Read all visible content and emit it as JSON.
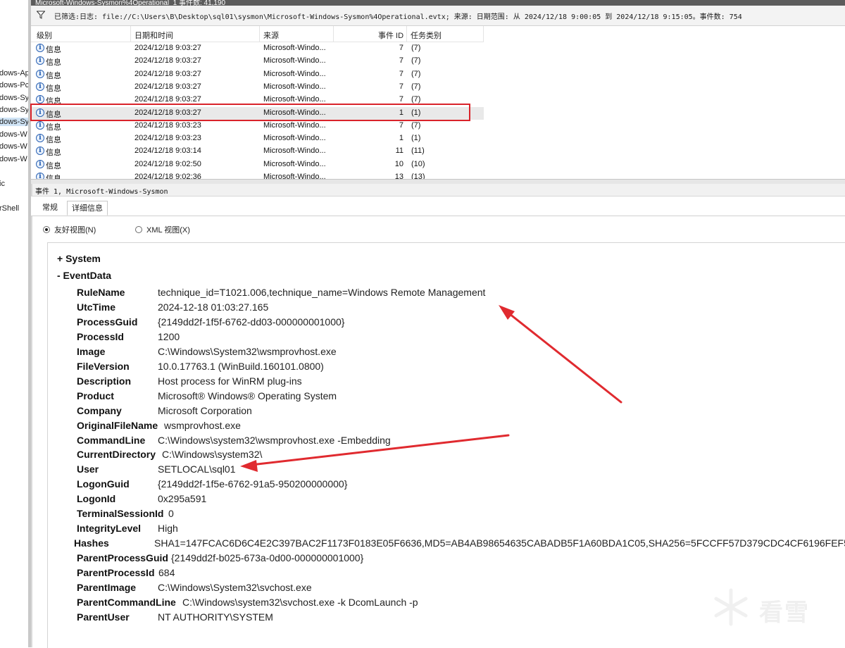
{
  "window": {
    "title": "Microsoft-Windows-Sysmon%4Operational_1    事件数: 41,190"
  },
  "sidebar": {
    "items": [
      {
        "label": "dows-Ap"
      },
      {
        "label": "dows-Pc"
      },
      {
        "label": "dows-Sy"
      },
      {
        "label": "dows-Sy"
      },
      {
        "label": "dows-Sy"
      },
      {
        "label": "dows-W"
      },
      {
        "label": "dows-W"
      },
      {
        "label": "dows-W"
      },
      {
        "label": "ic"
      },
      {
        "label": "rShell"
      }
    ]
  },
  "filter": {
    "icon": "filter-icon",
    "text": "已筛选:日志: file://C:\\Users\\B\\Desktop\\sql01\\sysmon\\Microsoft-Windows-Sysmon%4Operational.evtx; 来源: 日期范围: 从 2024/12/18 9:00:05 到 2024/12/18 9:15:05。事件数: 754"
  },
  "events_table": {
    "columns": [
      "级别",
      "日期和时间",
      "来源",
      "事件 ID",
      "任务类别"
    ],
    "rows": [
      {
        "level": "信息",
        "datetime": "2024/12/18 9:03:27",
        "source": "Microsoft-Windo...",
        "event_id": "7",
        "task": "(7)"
      },
      {
        "level": "信息",
        "datetime": "2024/12/18 9:03:27",
        "source": "Microsoft-Windo...",
        "event_id": "7",
        "task": "(7)"
      },
      {
        "level": "信息",
        "datetime": "2024/12/18 9:03:27",
        "source": "Microsoft-Windo...",
        "event_id": "7",
        "task": "(7)"
      },
      {
        "level": "信息",
        "datetime": "2024/12/18 9:03:27",
        "source": "Microsoft-Windo...",
        "event_id": "7",
        "task": "(7)"
      },
      {
        "level": "信息",
        "datetime": "2024/12/18 9:03:27",
        "source": "Microsoft-Windo...",
        "event_id": "7",
        "task": "(7)"
      },
      {
        "level": "信息",
        "datetime": "2024/12/18 9:03:27",
        "source": "Microsoft-Windo...",
        "event_id": "1",
        "task": "(1)"
      },
      {
        "level": "信息",
        "datetime": "2024/12/18 9:03:23",
        "source": "Microsoft-Windo...",
        "event_id": "7",
        "task": "(7)"
      },
      {
        "level": "信息",
        "datetime": "2024/12/18 9:03:23",
        "source": "Microsoft-Windo...",
        "event_id": "1",
        "task": "(1)"
      },
      {
        "level": "信息",
        "datetime": "2024/12/18 9:03:14",
        "source": "Microsoft-Windo...",
        "event_id": "11",
        "task": "(11)"
      },
      {
        "level": "信息",
        "datetime": "2024/12/18 9:02:50",
        "source": "Microsoft-Windo...",
        "event_id": "10",
        "task": "(10)"
      },
      {
        "level": "信息",
        "datetime": "2024/12/18 9:02:36",
        "source": "Microsoft-Windo...",
        "event_id": "13",
        "task": "(13)"
      }
    ],
    "selected_row": 5
  },
  "event_header": "事件 1, Microsoft-Windows-Sysmon",
  "tabs": {
    "general": "常规",
    "details": "详细信息"
  },
  "view_options": {
    "friendly": "友好视图(N)",
    "xml": "XML 视图(X)"
  },
  "details": {
    "system_label": "+  System",
    "eventdata_label": "-  EventData",
    "fields": [
      {
        "name": "RuleName",
        "value": "technique_id=T1021.006,technique_name=Windows Remote Management"
      },
      {
        "name": "UtcTime",
        "value": "2024-12-18 01:03:27.165"
      },
      {
        "name": "ProcessGuid",
        "value": "{2149dd2f-1f5f-6762-dd03-000000001000}"
      },
      {
        "name": "ProcessId",
        "value": "1200"
      },
      {
        "name": "Image",
        "value": "C:\\Windows\\System32\\wsmprovhost.exe"
      },
      {
        "name": "FileVersion",
        "value": "10.0.17763.1 (WinBuild.160101.0800)"
      },
      {
        "name": "Description",
        "value": "Host process for WinRM plug-ins"
      },
      {
        "name": "Product",
        "value": "Microsoft® Windows® Operating System"
      },
      {
        "name": "Company",
        "value": "Microsoft Corporation"
      },
      {
        "name": "OriginalFileName",
        "value": "wsmprovhost.exe"
      },
      {
        "name": "CommandLine",
        "value": "C:\\Windows\\system32\\wsmprovhost.exe -Embedding"
      },
      {
        "name": "CurrentDirectory",
        "value": "C:\\Windows\\system32\\"
      },
      {
        "name": "User",
        "value": "SETLOCAL\\sql01"
      },
      {
        "name": "LogonGuid",
        "value": "{2149dd2f-1f5e-6762-91a5-950200000000}"
      },
      {
        "name": "LogonId",
        "value": "0x295a591"
      },
      {
        "name": "TerminalSessionId",
        "value": "0"
      },
      {
        "name": "IntegrityLevel",
        "value": "High"
      },
      {
        "name": "Hashes",
        "value": "SHA1=147FCAC6D6C4E2C397BAC2F1173F0183E05F6636,MD5=AB4AB98654635CABADB5F1A60BDA1C05,SHA256=5FCCFF57D379CDC4CF6196FEF5"
      },
      {
        "name": "ParentProcessGuid",
        "value": "{2149dd2f-b025-673a-0d00-000000001000}"
      },
      {
        "name": "ParentProcessId",
        "value": "684"
      },
      {
        "name": "ParentImage",
        "value": "C:\\Windows\\System32\\svchost.exe"
      },
      {
        "name": "ParentCommandLine",
        "value": "C:\\Windows\\system32\\svchost.exe -k DcomLaunch -p"
      },
      {
        "name": "ParentUser",
        "value": "NT AUTHORITY\\SYSTEM"
      }
    ]
  },
  "annotations": {
    "highlight_color": "#d9232a"
  },
  "watermark": {
    "text": "看雪",
    "icon": "snowflake-logo-icon"
  }
}
